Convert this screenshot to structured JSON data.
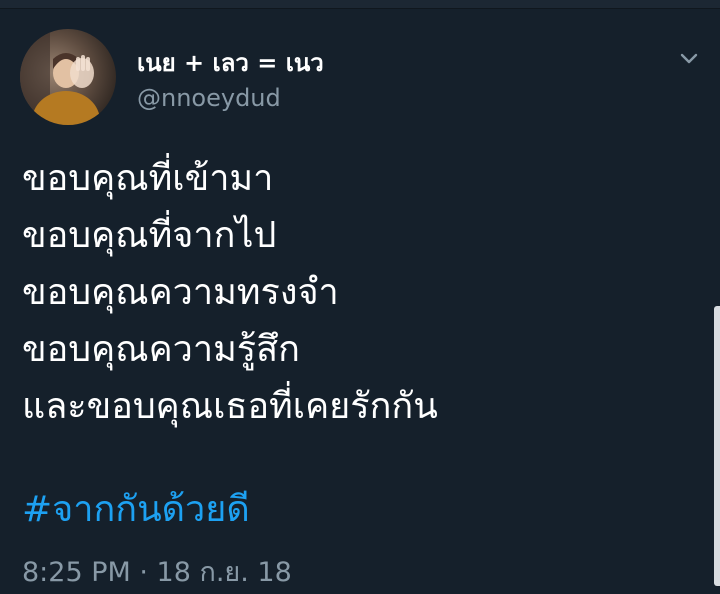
{
  "tweet": {
    "author": {
      "display_name": "เนย + เลว = เนว",
      "handle": "@nnoeydud"
    },
    "lines": [
      "ขอบคุณที่เข้ามา",
      "ขอบคุณที่จากไป",
      "ขอบคุณความทรงจำ",
      "ขอบคุณความรู้สึก",
      "และขอบคุณเธอที่เคยรักกัน"
    ],
    "hashtag": "#จากกันด้วยดี",
    "timestamp": "8:25 PM · 18 ก.ย. 18"
  },
  "icons": {
    "menu": "chevron-down-icon"
  },
  "colors": {
    "background": "#15202b",
    "text": "#ffffff",
    "secondary_text": "#8899a6",
    "hashtag": "#1da1f2"
  }
}
